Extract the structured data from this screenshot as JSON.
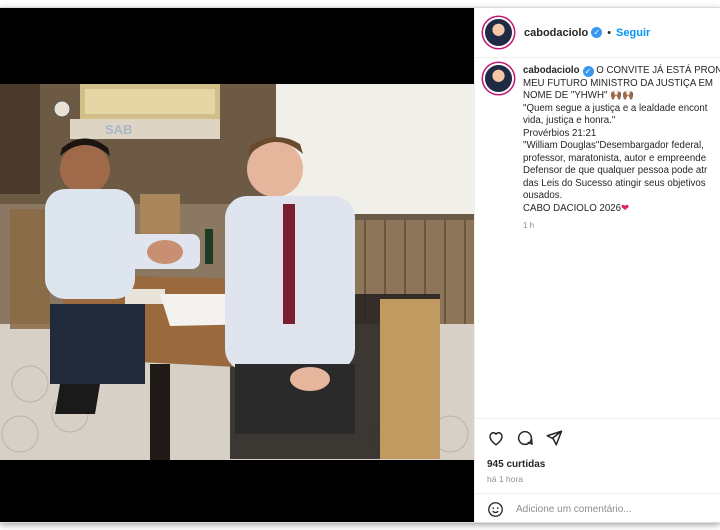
{
  "post": {
    "username": "cabodaciolo",
    "follow_label": "Seguir",
    "separator": "•",
    "caption_lines": [
      "O CONVITE JÁ ESTÁ PRON",
      "MEU FUTURO MINISTRO DA JUSTIÇA EM",
      "NOME DE \"YHWH\" 🙌🏾🙌🏾",
      "\"Quem segue a justiça e a lealdade encont",
      "vida, justiça e honra.\"",
      "Provérbios 21:21",
      "\"William Douglas\"Desembargador federal,",
      "professor, maratonista, autor e empreende",
      "Defensor de que qualquer pessoa pode atr",
      "das Leis do Sucesso atingir seus objetivos",
      "ousados.",
      "CABO DACIOLO 2026"
    ],
    "caption_heart": "❤",
    "caption_time": "1 h",
    "likes": "945 curtidas",
    "posted": "há 1 hora",
    "comment_placeholder": "Adicione um comentário..."
  },
  "photo": {
    "sign": "SAB"
  },
  "colors": {
    "follow": "#0095f6",
    "verified": "#3897f0",
    "story_ring": "#c2166f"
  }
}
